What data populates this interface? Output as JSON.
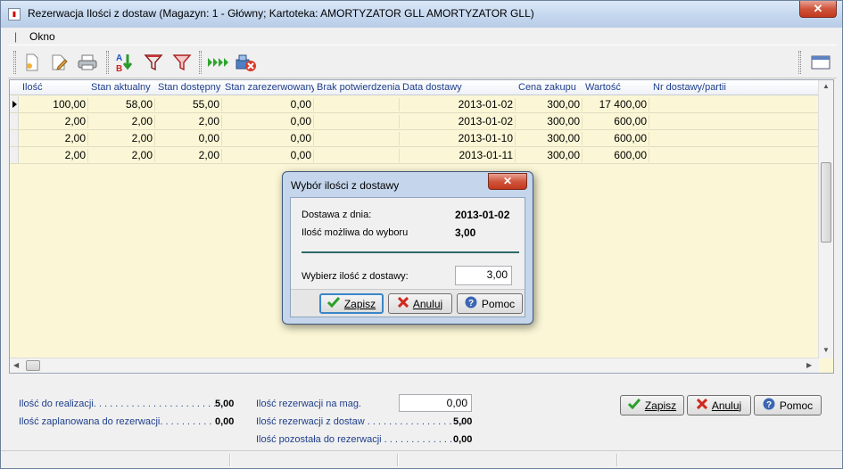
{
  "window": {
    "title": "Rezerwacja Ilości z dostaw (Magazyn: 1 - Główny; Kartoteka: AMORTYZATOR GLL AMORTYZATOR GLL)",
    "close_label": "✕"
  },
  "menu": {
    "items": [
      "Okno"
    ]
  },
  "toolbar": {
    "icons": [
      "new-document-icon",
      "edit-document-icon",
      "print-icon",
      "sort-ab-icon",
      "filter-icon",
      "filter-red-icon",
      "run-green-arrows-icon",
      "connection-error-icon",
      "layout-settings-icon"
    ]
  },
  "grid": {
    "columns": [
      "Ilość",
      "Stan aktualny",
      "Stan dostępny",
      "Stan zarezerwowany",
      "Brak potwierdzenia",
      "Data dostawy",
      "Cena zakupu",
      "Wartość",
      "Nr dostawy/partii"
    ],
    "rows": [
      {
        "ilosc": "100,00",
        "stan_aktualny": "58,00",
        "stan_dostepny": "55,00",
        "stan_zarezerwowany": "0,00",
        "brak_potwierdzenia": "",
        "data_dostawy": "2013-01-02",
        "cena_zakupu": "300,00",
        "wartosc": "17 400,00",
        "nr_dostawy": ""
      },
      {
        "ilosc": "2,00",
        "stan_aktualny": "2,00",
        "stan_dostepny": "2,00",
        "stan_zarezerwowany": "0,00",
        "brak_potwierdzenia": "",
        "data_dostawy": "2013-01-02",
        "cena_zakupu": "300,00",
        "wartosc": "600,00",
        "nr_dostawy": ""
      },
      {
        "ilosc": "2,00",
        "stan_aktualny": "2,00",
        "stan_dostepny": "0,00",
        "stan_zarezerwowany": "0,00",
        "brak_potwierdzenia": "",
        "data_dostawy": "2013-01-10",
        "cena_zakupu": "300,00",
        "wartosc": "600,00",
        "nr_dostawy": ""
      },
      {
        "ilosc": "2,00",
        "stan_aktualny": "2,00",
        "stan_dostepny": "2,00",
        "stan_zarezerwowany": "0,00",
        "brak_potwierdzenia": "",
        "data_dostawy": "2013-01-11",
        "cena_zakupu": "300,00",
        "wartosc": "600,00",
        "nr_dostawy": ""
      }
    ]
  },
  "summary": {
    "ilosc_do_realizacji_label": "Ilość do realizacji",
    "ilosc_do_realizacji": "5,00",
    "ilosc_zaplanowana_label": "Ilość zaplanowana do rezerwacji",
    "ilosc_zaplanowana": "0,00",
    "rezerwacji_na_mag_label": "Ilość rezerwacji na mag.",
    "rezerwacji_na_mag": "0,00",
    "rezerwacji_z_dostaw_label": "Ilość rezerwacji z dostaw",
    "rezerwacji_z_dostaw": "5,00",
    "pozostala_label": "Ilość pozostała do rezerwacji",
    "pozostala": "0,00"
  },
  "buttons": {
    "zapisz": "Zapisz",
    "anuluj": "Anuluj",
    "pomoc": "Pomoc"
  },
  "dialog": {
    "title": "Wybór ilości z dostawy",
    "dostawa_label": "Dostawa z dnia:",
    "dostawa_value": "2013-01-02",
    "mozliwa_label": "Ilość możliwa do wyboru",
    "mozliwa_value": "3,00",
    "wybierz_label": "Wybierz ilość z dostawy:",
    "wybierz_value": "3,00",
    "zapisz": "Zapisz",
    "anuluj": "Anuluj",
    "pomoc": "Pomoc"
  },
  "colors": {
    "grid_bg": "#fbf7d6",
    "label_blue": "#1e3f8c",
    "ok_green": "#2aa02a",
    "cancel_red": "#d0281e",
    "help_blue": "#3c66b4"
  }
}
